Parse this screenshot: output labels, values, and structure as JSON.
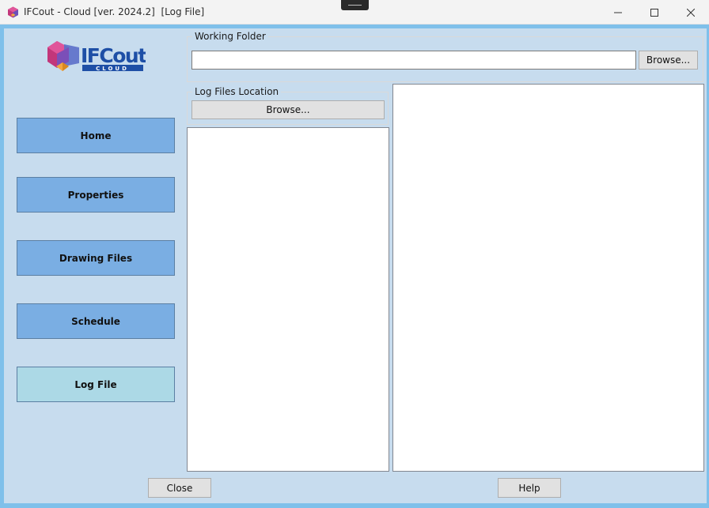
{
  "window": {
    "title": "IFCout - Cloud [ver. 2024.2]  [Log File]",
    "icons": {
      "app": "ifcout-app-icon",
      "minimize": "minimize-icon",
      "maximize": "maximize-icon",
      "close": "close-icon"
    }
  },
  "logo": {
    "text": "IFCout",
    "subtext": "CLOUD"
  },
  "nav": {
    "items": [
      {
        "label": "Home"
      },
      {
        "label": "Properties"
      },
      {
        "label": "Drawing Files"
      },
      {
        "label": "Schedule"
      },
      {
        "label": "Log File",
        "active": true
      }
    ]
  },
  "working_folder": {
    "legend": "Working Folder",
    "value": "",
    "browse_label": "Browse..."
  },
  "log_files_location": {
    "legend": "Log Files Location",
    "browse_label": "Browse..."
  },
  "log_file_list": {
    "items": []
  },
  "log_content": {
    "text": ""
  },
  "footer": {
    "close_label": "Close",
    "help_label": "Help"
  },
  "colors": {
    "frame": "#7fc0ea",
    "client": "#c7dcee",
    "nav_button": "#7aaee3",
    "nav_active": "#acd9e6"
  }
}
